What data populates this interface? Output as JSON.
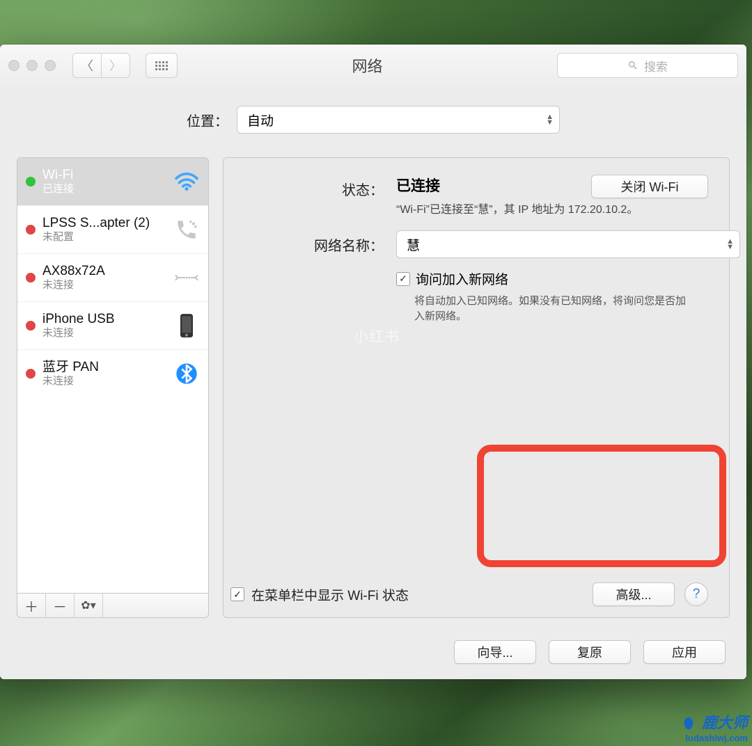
{
  "window": {
    "title": "网络"
  },
  "search": {
    "placeholder": "搜索"
  },
  "location": {
    "label": "位置：",
    "value": "自动"
  },
  "interfaces": [
    {
      "name": "Wi-Fi",
      "status": "已连接",
      "dot": "green",
      "icon": "wifi",
      "selected": true
    },
    {
      "name": "LPSS S...apter (2)",
      "status": "未配置",
      "dot": "red",
      "icon": "phone",
      "selected": false
    },
    {
      "name": "AX88x72A",
      "status": "未连接",
      "dot": "red",
      "icon": "ethernet",
      "selected": false
    },
    {
      "name": "iPhone USB",
      "status": "未连接",
      "dot": "red",
      "icon": "iphone",
      "selected": false
    },
    {
      "name": "蓝牙 PAN",
      "status": "未连接",
      "dot": "red",
      "icon": "bluetooth",
      "selected": false
    }
  ],
  "detail": {
    "status_label": "状态：",
    "status_value": "已连接",
    "turn_off_btn": "关闭 Wi-Fi",
    "status_desc": "“Wi-Fi”已连接至“慧”，其 IP 地址为 172.20.10.2。",
    "network_label": "网络名称：",
    "network_value": "慧",
    "ask_join_label": "询问加入新网络",
    "ask_join_desc": "将自动加入已知网络。如果没有已知网络，将询问您是否加入新网络。",
    "show_menubar_label": "在菜单栏中显示 Wi-Fi 状态",
    "advanced_btn": "高级..."
  },
  "footer": {
    "wizard": "向导...",
    "revert": "复原",
    "apply": "应用"
  },
  "watermark": "小红书",
  "brand": {
    "name": "鹿大师",
    "url": "ludashiwj.com"
  }
}
